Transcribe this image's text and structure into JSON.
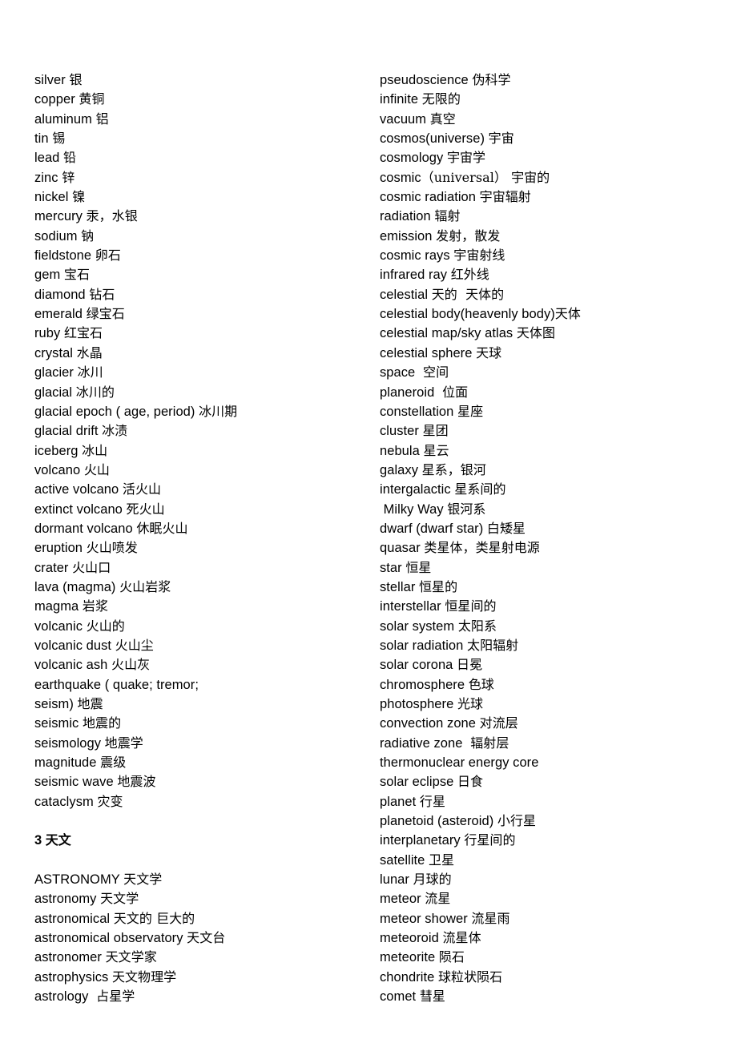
{
  "page": {
    "title": "Science vocabulary list — English / Chinese",
    "background_color": "#ffffff",
    "text_color": "#000000",
    "columns": 2
  },
  "left_column": {
    "name": "left-column",
    "lines": [
      {
        "type": "entry",
        "en": "silver ",
        "cn": "银"
      },
      {
        "type": "entry",
        "en": "copper ",
        "cn": "黄铜"
      },
      {
        "type": "entry",
        "en": "aluminum ",
        "cn": "铝"
      },
      {
        "type": "entry",
        "en": "tin ",
        "cn": "锡"
      },
      {
        "type": "entry",
        "en": "lead ",
        "cn": "铅"
      },
      {
        "type": "entry",
        "en": "zinc ",
        "cn": "锌"
      },
      {
        "type": "entry",
        "en": "nickel ",
        "cn": "镍"
      },
      {
        "type": "entry",
        "en": "mercury ",
        "cn": "汞，水银"
      },
      {
        "type": "entry",
        "en": "sodium ",
        "cn": "钠"
      },
      {
        "type": "entry",
        "en": "fieldstone ",
        "cn": "卵石"
      },
      {
        "type": "entry",
        "en": "gem ",
        "cn": "宝石"
      },
      {
        "type": "entry",
        "en": "diamond ",
        "cn": "钻石"
      },
      {
        "type": "entry",
        "en": "emerald ",
        "cn": "绿宝石"
      },
      {
        "type": "entry",
        "en": "ruby ",
        "cn": "红宝石"
      },
      {
        "type": "entry",
        "en": "crystal ",
        "cn": "水晶"
      },
      {
        "type": "entry",
        "en": "glacier ",
        "cn": "冰川"
      },
      {
        "type": "entry",
        "en": "glacial ",
        "cn": "冰川的"
      },
      {
        "type": "entry",
        "en": "glacial epoch ( age, period) ",
        "cn": "冰川期"
      },
      {
        "type": "entry",
        "en": "glacial drift ",
        "cn": "冰渍"
      },
      {
        "type": "entry",
        "en": "iceberg ",
        "cn": "冰山"
      },
      {
        "type": "entry",
        "en": "volcano ",
        "cn": "火山"
      },
      {
        "type": "entry",
        "en": "active volcano ",
        "cn": "活火山"
      },
      {
        "type": "entry",
        "en": "extinct volcano ",
        "cn": "死火山"
      },
      {
        "type": "entry",
        "en": "dormant volcano ",
        "cn": "休眠火山"
      },
      {
        "type": "entry",
        "en": "eruption ",
        "cn": "火山喷发"
      },
      {
        "type": "entry",
        "en": "crater ",
        "cn": "火山口"
      },
      {
        "type": "entry",
        "en": "lava (magma) ",
        "cn": "火山岩浆"
      },
      {
        "type": "entry",
        "en": "magma ",
        "cn": "岩浆"
      },
      {
        "type": "entry",
        "en": "volcanic ",
        "cn": "火山的"
      },
      {
        "type": "entry",
        "en": "volcanic dust ",
        "cn": "火山尘"
      },
      {
        "type": "entry",
        "en": "volcanic ash ",
        "cn": "火山灰"
      },
      {
        "type": "entry",
        "en": "earthquake ( quake; tremor;",
        "cn": ""
      },
      {
        "type": "entry",
        "en": "seism) ",
        "cn": "地震"
      },
      {
        "type": "entry",
        "en": "seismic ",
        "cn": "地震的"
      },
      {
        "type": "entry",
        "en": "seismology ",
        "cn": "地震学"
      },
      {
        "type": "entry",
        "en": "magnitude ",
        "cn": "震级"
      },
      {
        "type": "entry",
        "en": "seismic wave ",
        "cn": "地震波"
      },
      {
        "type": "entry",
        "en": "cataclysm ",
        "cn": "灾变"
      },
      {
        "type": "blank",
        "en": "",
        "cn": ""
      },
      {
        "type": "heading",
        "en": "3 ",
        "cn": "天文"
      },
      {
        "type": "blank",
        "en": "",
        "cn": ""
      },
      {
        "type": "entry",
        "en": "ASTRONOMY ",
        "cn": "天文学"
      },
      {
        "type": "entry",
        "en": "astronomy ",
        "cn": "天文学"
      },
      {
        "type": "entry",
        "en": "astronomical ",
        "cn": "天文的 巨大的"
      },
      {
        "type": "entry",
        "en": "astronomical observatory ",
        "cn": "天文台"
      },
      {
        "type": "entry",
        "en": "astronomer ",
        "cn": "天文学家"
      },
      {
        "type": "entry",
        "en": "astrophysics ",
        "cn": "天文物理学"
      },
      {
        "type": "entry",
        "en": "astrology ",
        "cn": " 占星学"
      }
    ]
  },
  "right_column": {
    "name": "right-column",
    "lines": [
      {
        "type": "entry",
        "en": "pseudoscience ",
        "cn": "伪科学"
      },
      {
        "type": "entry",
        "en": "infinite ",
        "cn": "无限的"
      },
      {
        "type": "entry",
        "en": "vacuum ",
        "cn": "真空"
      },
      {
        "type": "entry",
        "en": "cosmos(universe) ",
        "cn": "宇宙"
      },
      {
        "type": "entry",
        "en": "cosmology ",
        "cn": "宇宙学"
      },
      {
        "type": "entry",
        "en": "cosmic",
        "cn": "（universal） 宇宙的"
      },
      {
        "type": "entry",
        "en": "cosmic radiation ",
        "cn": "宇宙辐射"
      },
      {
        "type": "entry",
        "en": "radiation ",
        "cn": "辐射"
      },
      {
        "type": "entry",
        "en": "emission ",
        "cn": "发射，散发"
      },
      {
        "type": "entry",
        "en": "cosmic rays ",
        "cn": "宇宙射线"
      },
      {
        "type": "entry",
        "en": "infrared ray ",
        "cn": "红外线"
      },
      {
        "type": "entry",
        "en": "celestial ",
        "cn": "天的  天体的"
      },
      {
        "type": "entry",
        "en": "celestial body(heavenly body)",
        "cn": "天体"
      },
      {
        "type": "entry",
        "en": "celestial map/sky atlas ",
        "cn": "天体图"
      },
      {
        "type": "entry",
        "en": "celestial sphere ",
        "cn": "天球"
      },
      {
        "type": "entry",
        "en": "space ",
        "cn": " 空间"
      },
      {
        "type": "entry",
        "en": "planeroid ",
        "cn": " 位面"
      },
      {
        "type": "entry",
        "en": "constellation ",
        "cn": "星座"
      },
      {
        "type": "entry",
        "en": "cluster ",
        "cn": "星团"
      },
      {
        "type": "entry",
        "en": "nebula ",
        "cn": "星云"
      },
      {
        "type": "entry",
        "en": "galaxy ",
        "cn": "星系，银河"
      },
      {
        "type": "entry",
        "en": "intergalactic ",
        "cn": "星系间的"
      },
      {
        "type": "entry",
        "en": " Milky Way ",
        "cn": "银河系"
      },
      {
        "type": "entry",
        "en": "dwarf (dwarf star) ",
        "cn": "白矮星"
      },
      {
        "type": "entry",
        "en": "quasar ",
        "cn": "类星体，类星射电源"
      },
      {
        "type": "entry",
        "en": "star ",
        "cn": "恒星"
      },
      {
        "type": "entry",
        "en": "stellar ",
        "cn": "恒星的"
      },
      {
        "type": "entry",
        "en": "interstellar ",
        "cn": "恒星间的"
      },
      {
        "type": "entry",
        "en": "solar system ",
        "cn": "太阳系"
      },
      {
        "type": "entry",
        "en": "solar radiation ",
        "cn": "太阳辐射"
      },
      {
        "type": "entry",
        "en": "solar corona ",
        "cn": "日冕"
      },
      {
        "type": "entry",
        "en": "chromosphere ",
        "cn": "色球"
      },
      {
        "type": "entry",
        "en": "photosphere ",
        "cn": "光球"
      },
      {
        "type": "entry",
        "en": "convection zone ",
        "cn": "对流层"
      },
      {
        "type": "entry",
        "en": "radiative zone ",
        "cn": " 辐射层"
      },
      {
        "type": "entry",
        "en": "thermonuclear energy core",
        "cn": ""
      },
      {
        "type": "entry",
        "en": "solar eclipse ",
        "cn": "日食"
      },
      {
        "type": "entry",
        "en": "planet ",
        "cn": "行星"
      },
      {
        "type": "entry",
        "en": "planetoid (asteroid) ",
        "cn": "小行星"
      },
      {
        "type": "entry",
        "en": "interplanetary ",
        "cn": "行星间的"
      },
      {
        "type": "entry",
        "en": "satellite ",
        "cn": "卫星"
      },
      {
        "type": "entry",
        "en": "lunar ",
        "cn": "月球的"
      },
      {
        "type": "entry",
        "en": "meteor ",
        "cn": "流星"
      },
      {
        "type": "entry",
        "en": "meteor shower ",
        "cn": "流星雨"
      },
      {
        "type": "entry",
        "en": "meteoroid ",
        "cn": "流星体"
      },
      {
        "type": "entry",
        "en": "meteorite ",
        "cn": "陨石"
      },
      {
        "type": "entry",
        "en": "chondrite ",
        "cn": "球粒状陨石"
      },
      {
        "type": "entry",
        "en": "comet ",
        "cn": "彗星"
      }
    ]
  }
}
